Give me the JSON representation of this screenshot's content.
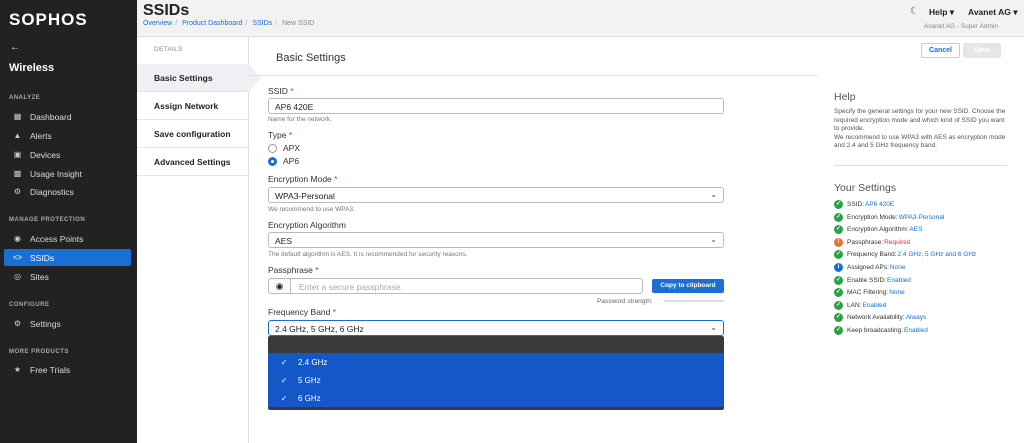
{
  "brand": "SOPHOS",
  "app_title": "Wireless",
  "back_icon": "arrow-left-icon",
  "sidebar": {
    "sections": [
      {
        "label": "ANALYZE"
      },
      {
        "label": "MANAGE PROTECTION"
      },
      {
        "label": "CONFIGURE"
      },
      {
        "label": "MORE PRODUCTS"
      }
    ],
    "items": [
      {
        "label": "Dashboard",
        "icon": "dashboard-icon"
      },
      {
        "label": "Alerts",
        "icon": "bell-icon"
      },
      {
        "label": "Devices",
        "icon": "devices-icon"
      },
      {
        "label": "Usage Insight",
        "icon": "chart-icon"
      },
      {
        "label": "Diagnostics",
        "icon": "gear-icon"
      },
      {
        "label": "Access Points",
        "icon": "wifi-icon"
      },
      {
        "label": "SSIDs",
        "icon": "code-icon",
        "active": true
      },
      {
        "label": "Sites",
        "icon": "globe-icon"
      },
      {
        "label": "Settings",
        "icon": "gear-icon"
      },
      {
        "label": "Free Trials",
        "icon": "star-icon"
      }
    ]
  },
  "header": {
    "title": "SSIDs",
    "breadcrumbs": [
      "Overview",
      "Product Dashboard",
      "SSIDs",
      "New SSID"
    ],
    "help_menu": "Help",
    "org_menu": "Avanet AG",
    "role": "Avanet AG - Super Admin"
  },
  "steps": {
    "label": "DETAILS",
    "items": [
      "Basic Settings",
      "Assign Network",
      "Save configuration",
      "Advanced Settings"
    ]
  },
  "form": {
    "title": "Basic Settings",
    "ssid_label": "SSID",
    "ssid_value": "AP6 420E",
    "ssid_hint": "Name for the network.",
    "type_label": "Type",
    "type_options": [
      "APX",
      "AP6"
    ],
    "type_selected": "AP6",
    "enc_mode_label": "Encryption Mode",
    "enc_mode_value": "WPA3-Personal",
    "enc_mode_hint": "We recommend to use WPA3.",
    "enc_alg_label": "Encryption Algorithm",
    "enc_alg_value": "AES",
    "enc_alg_hint": "The default algorithm is AES. It is recommended for security reasons.",
    "pass_label": "Passphrase",
    "pass_placeholder": "Enter a secure passphrase.",
    "copy_label": "Copy to clipboard",
    "strength_label": "Password strength:",
    "freq_label": "Frequency Band",
    "freq_value": "2.4 GHz, 5 GHz, 6 GHz",
    "freq_options": [
      "2.4 GHz",
      "5 GHz",
      "6 GHz"
    ],
    "required_mark": "*"
  },
  "actions": {
    "cancel": "Cancel",
    "save": "Save"
  },
  "help": {
    "title": "Help",
    "text": "Specify the general settings for your new SSID. Choose the required encryption mode and which kind of SSID you want to provide.\nWe recommend to use WPA3 with AES as encryption mode and 2.4 and 5 GHz frequency band."
  },
  "your_settings": {
    "title": "Your Settings",
    "items": [
      {
        "label": "SSID:",
        "value": "AP6 420E",
        "status": "ok"
      },
      {
        "label": "Encryption Mode:",
        "value": "WPA3-Personal",
        "status": "ok"
      },
      {
        "label": "Encryption Algorithm:",
        "value": "AES",
        "status": "ok"
      },
      {
        "label": "Passphrase:",
        "value": "Required",
        "status": "warn"
      },
      {
        "label": "Frequency Band:",
        "value": "2.4 GHz, 5 GHz and 6 GHz",
        "status": "ok"
      },
      {
        "label": "Assigned APs:",
        "value": "None",
        "status": "info"
      },
      {
        "label": "Enable SSID:",
        "value": "Enabled",
        "status": "ok"
      },
      {
        "label": "MAC Filtering:",
        "value": "None",
        "status": "ok"
      },
      {
        "label": "LAN:",
        "value": "Enabled",
        "status": "ok"
      },
      {
        "label": "Network Availability:",
        "value": "Always",
        "status": "ok"
      },
      {
        "label": "Keep broadcasting:",
        "value": "Enabled",
        "status": "ok"
      }
    ]
  },
  "colors": {
    "accent": "#1a6fd4",
    "sidebar_bg": "#222222",
    "dropdown_selected": "#1457c8",
    "ok": "#2ea043",
    "warn": "#e8742f"
  }
}
